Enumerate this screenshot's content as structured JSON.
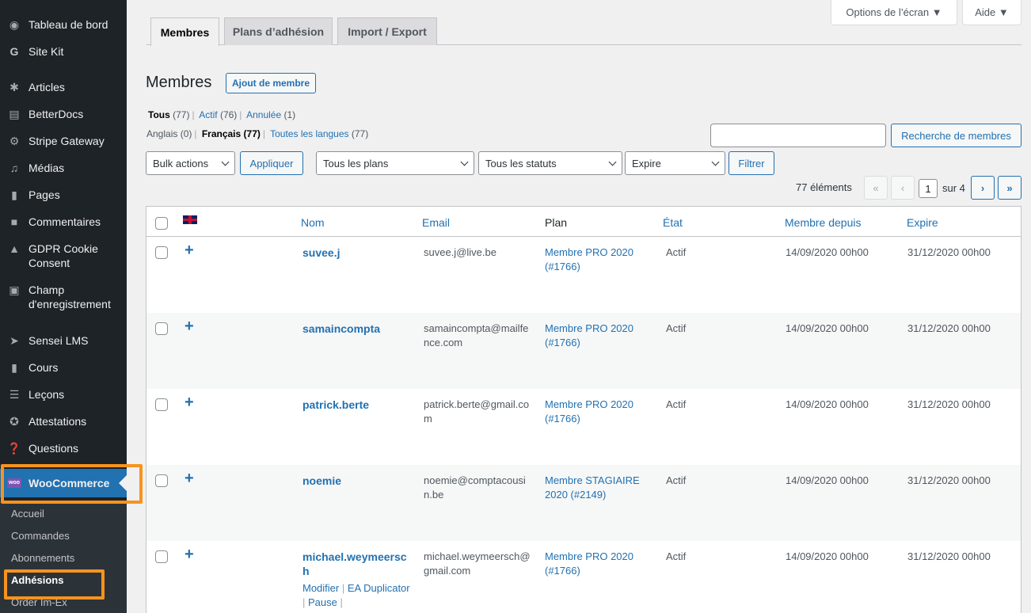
{
  "sidebar": {
    "items": [
      {
        "label": "Tableau de bord",
        "icon": "dashboard-icon"
      },
      {
        "label": "Site Kit",
        "icon": "google-icon"
      },
      {
        "label": "Articles",
        "icon": "pin-icon"
      },
      {
        "label": "BetterDocs",
        "icon": "docs-icon"
      },
      {
        "label": "Stripe Gateway",
        "icon": "gear-icon"
      },
      {
        "label": "Médias",
        "icon": "media-icon"
      },
      {
        "label": "Pages",
        "icon": "pages-icon"
      },
      {
        "label": "Commentaires",
        "icon": "comment-icon"
      },
      {
        "label": "GDPR Cookie",
        "label2": "Consent",
        "icon": "lock-icon"
      },
      {
        "label": "Champ",
        "label2": "d'enregistrement",
        "icon": "field-icon"
      },
      {
        "label": "Sensei LMS",
        "icon": "sensei-icon"
      },
      {
        "label": "Cours",
        "icon": "book-icon"
      },
      {
        "label": "Leçons",
        "icon": "list-icon"
      },
      {
        "label": "Attestations",
        "icon": "award-icon"
      },
      {
        "label": "Questions",
        "icon": "question-icon"
      }
    ],
    "active": {
      "label": "WooCommerce",
      "logo_text": "woo"
    },
    "submenu": [
      "Accueil",
      "Commandes",
      "Abonnements",
      "Adhésions",
      "Order Im-Ex"
    ]
  },
  "top": {
    "screen_options": "Options de l’écran ▼",
    "help": "Aide ▼"
  },
  "tabs": [
    "Membres",
    "Plans d’adhésion",
    "Import / Export"
  ],
  "page": {
    "title": "Membres",
    "add_button": "Ajout de membre"
  },
  "filters": {
    "status": {
      "all_label": "Tous",
      "all_count": "(77)",
      "active_label": "Actif",
      "active_count": "(76)",
      "cancelled_label": "Annulée",
      "cancelled_count": "(1)"
    },
    "languages": {
      "english": "Anglais (0)",
      "french_label": "Français",
      "french_count": "(77)",
      "all_label": "Toutes les langues",
      "all_count": "(77)"
    },
    "search_button": "Recherche de membres",
    "bulk_actions": "Bulk actions",
    "apply": "Appliquer",
    "plans_select": "Tous les plans",
    "statuses_select": "Tous les statuts",
    "expire_select": "Expire",
    "filter_button": "Filtrer"
  },
  "pagination": {
    "count": "77 éléments",
    "first": "«",
    "prev": "‹",
    "current": "1",
    "of": "sur 4",
    "next": "›",
    "last": "»"
  },
  "table": {
    "headers": {
      "name": "Nom",
      "email": "Email",
      "plan": "Plan",
      "state": "État",
      "since": "Membre depuis",
      "expire": "Expire"
    },
    "rows": [
      {
        "name": "suvee.j",
        "email": "suvee.j@live.be",
        "plan": "Membre PRO 2020 (#1766)",
        "state": "Actif",
        "since": "14/09/2020 00h00",
        "expire": "31/12/2020 00h00"
      },
      {
        "name": "samaincompta",
        "email": "samaincompta@mailfence.com",
        "plan": "Membre PRO 2020 (#1766)",
        "state": "Actif",
        "since": "14/09/2020 00h00",
        "expire": "31/12/2020 00h00"
      },
      {
        "name": "patrick.berte",
        "email": "patrick.berte@gmail.com",
        "plan": "Membre PRO 2020 (#1766)",
        "state": "Actif",
        "since": "14/09/2020 00h00",
        "expire": "31/12/2020 00h00"
      },
      {
        "name": "noemie",
        "email": "noemie@comptacousin.be",
        "plan": "Membre STAGIAIRE 2020 (#2149)",
        "state": "Actif",
        "since": "14/09/2020 00h00",
        "expire": "31/12/2020 00h00"
      },
      {
        "name": "michael.weymeersch",
        "email": "michael.weymeersch@gmail.com",
        "plan": "Membre PRO 2020 (#1766)",
        "state": "Actif",
        "since": "14/09/2020 00h00",
        "expire": "31/12/2020 00h00"
      }
    ],
    "row_actions": {
      "edit": "Modifier",
      "duplicator": "EA Duplicator",
      "pause": "Pause"
    }
  }
}
